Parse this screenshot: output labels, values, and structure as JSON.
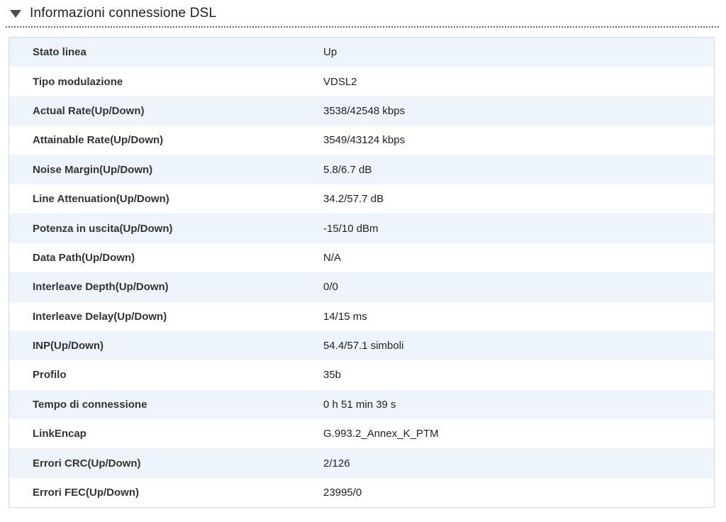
{
  "header": {
    "title": "Informazioni connessione DSL",
    "collapse_icon": "triangle-down"
  },
  "table": {
    "rows": [
      {
        "label": "Stato linea",
        "value": "Up"
      },
      {
        "label": "Tipo modulazione",
        "value": "VDSL2"
      },
      {
        "label": "Actual Rate(Up/Down)",
        "value": "3538/42548 kbps"
      },
      {
        "label": "Attainable Rate(Up/Down)",
        "value": "3549/43124 kbps"
      },
      {
        "label": "Noise Margin(Up/Down)",
        "value": "5.8/6.7 dB"
      },
      {
        "label": "Line Attenuation(Up/Down)",
        "value": "34.2/57.7 dB"
      },
      {
        "label": "Potenza in uscita(Up/Down)",
        "value": "-15/10 dBm"
      },
      {
        "label": "Data Path(Up/Down)",
        "value": "N/A"
      },
      {
        "label": "Interleave Depth(Up/Down)",
        "value": "0/0"
      },
      {
        "label": "Interleave Delay(Up/Down)",
        "value": "14/15 ms"
      },
      {
        "label": "INP(Up/Down)",
        "value": "54.4/57.1 simboli"
      },
      {
        "label": "Profilo",
        "value": "35b"
      },
      {
        "label": "Tempo di connessione",
        "value": "0 h 51 min 39 s"
      },
      {
        "label": "LinkEncap",
        "value": "G.993.2_Annex_K_PTM"
      },
      {
        "label": "Errori CRC(Up/Down)",
        "value": "2/126"
      },
      {
        "label": "Errori FEC(Up/Down)",
        "value": "23995/0"
      }
    ]
  },
  "colors": {
    "row_alt_background": "#eef4fb",
    "row_background": "#ffffff",
    "table_border": "#d6d9db",
    "label_text": "#333333",
    "value_text": "#222222",
    "title_text": "#1f1f1f",
    "collapse_icon": "#4d4d4d",
    "dotted_separator": "#6b6b6b"
  }
}
